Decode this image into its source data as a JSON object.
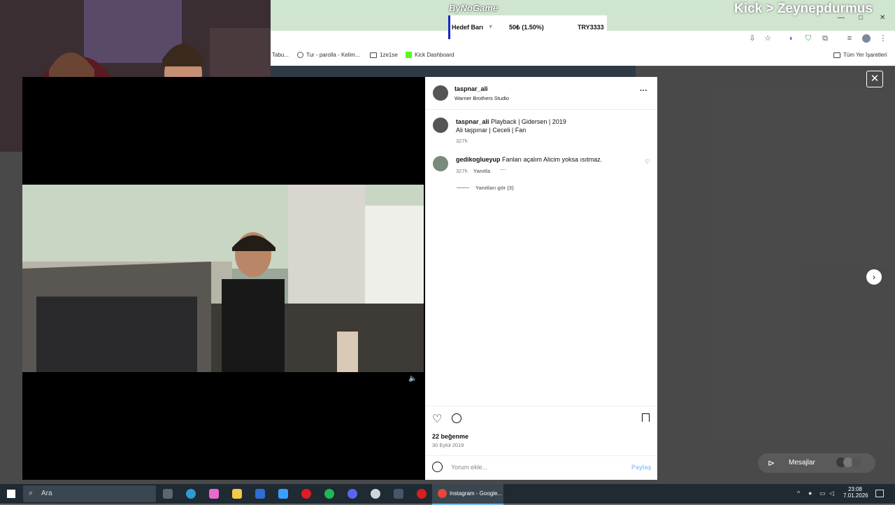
{
  "overlay": {
    "brand": "ByNoGame",
    "goal_label": "Hedef Barı",
    "goal_amount": "50₺ (1.50%)",
    "goal_target": "TRY3333",
    "kick_channel": "Kick > Zeynepdurmus"
  },
  "browser": {
    "bookmarks": [
      {
        "label": "Tabu...",
        "icon": "tab-icon"
      },
      {
        "label": "Tur - parolla - Kelim...",
        "icon": "globe-icon"
      },
      {
        "label": "1ze1se",
        "icon": "folder-icon"
      },
      {
        "label": "Kick Dashboard",
        "icon": "kick-icon"
      }
    ],
    "all_bookmarks": "Tüm Yer İşaretleri",
    "colors": {
      "kick_green": "#53fc18",
      "goal_blue": "#1726c8"
    }
  },
  "post": {
    "username": "taspnar_ali",
    "location": "Warner Brothers Studio",
    "caption_user": "taspnar_ali",
    "caption_line1": "Playback | Gidersen | 2019",
    "caption_line2": "Ali taşpınar | Ceceli | Fan",
    "caption_time": "327h",
    "comment_user": "gedikoglueyup",
    "comment_text": "Fanları açalım Alicim yoksa ısıtmaz.",
    "comment_time": "327h",
    "comment_reply": "Yanıtla",
    "view_replies": "Yanıtları gör (3)",
    "likes": "22 beğenme",
    "date": "30 Eylül 2019",
    "comment_placeholder": "Yorum ekle...",
    "share": "Paylaş",
    "messages": "Mesajlar"
  },
  "taskbar": {
    "search": "Ara",
    "active_app": "Instagram - Google...",
    "time": "23:08",
    "date": "7.01.2026"
  }
}
